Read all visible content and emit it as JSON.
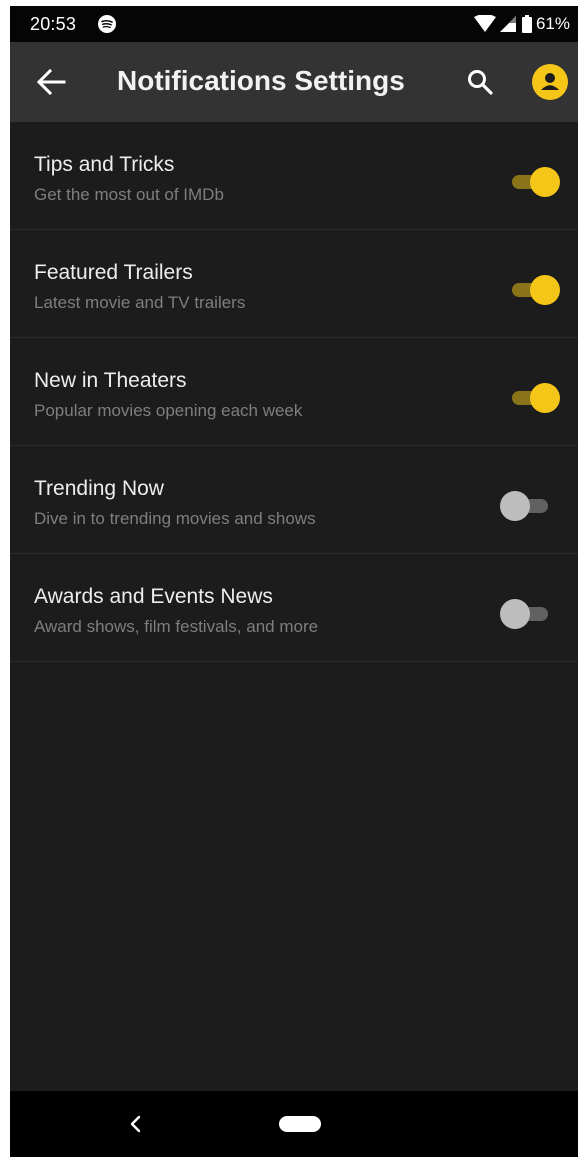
{
  "status_bar": {
    "time": "20:53",
    "battery": "61%",
    "icons": [
      "spotify-icon",
      "wifi-icon",
      "signal-icon",
      "battery-icon"
    ]
  },
  "app_bar": {
    "title": "Notifications Settings",
    "icons": [
      "back-arrow-icon",
      "search-icon",
      "account-icon"
    ]
  },
  "settings": [
    {
      "title": "Tips and Tricks",
      "subtitle": "Get the most out of IMDb",
      "enabled": true
    },
    {
      "title": "Featured Trailers",
      "subtitle": "Latest movie and TV trailers",
      "enabled": true
    },
    {
      "title": "New in Theaters",
      "subtitle": "Popular movies opening each week",
      "enabled": true
    },
    {
      "title": "Trending Now",
      "subtitle": "Dive in to trending movies and shows",
      "enabled": false
    },
    {
      "title": "Awards and Events News",
      "subtitle": "Award shows, film festivals, and more",
      "enabled": false
    }
  ],
  "nav_bar": {
    "icons": [
      "nav-back-icon",
      "home-pill-icon"
    ]
  },
  "colors": {
    "accent": "#f5c518",
    "background": "#1c1c1c",
    "app_bar": "#333333"
  }
}
